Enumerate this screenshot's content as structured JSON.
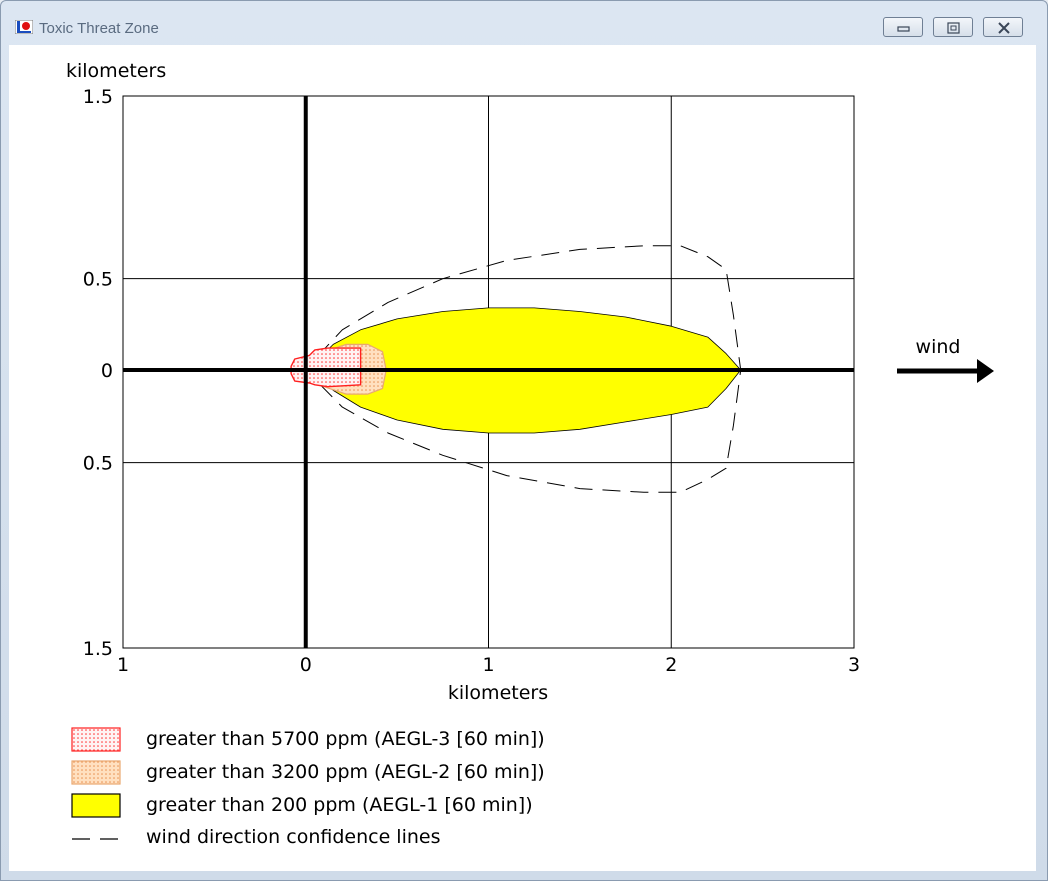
{
  "window": {
    "title": "Toxic Threat Zone",
    "controls": {
      "minimize": "minimize-icon",
      "maximize": "maximize-icon",
      "close": "close-icon"
    }
  },
  "chart_data": {
    "type": "area",
    "title": "",
    "ylabel": "kilometers",
    "xlabel": "kilometers",
    "xlim": [
      -1,
      3
    ],
    "ylim": [
      -1.5,
      1.5
    ],
    "x_ticks": [
      {
        "value": -1,
        "label": "1"
      },
      {
        "value": 0,
        "label": "0"
      },
      {
        "value": 1,
        "label": "1"
      },
      {
        "value": 2,
        "label": "2"
      },
      {
        "value": 3,
        "label": "3"
      }
    ],
    "y_ticks": [
      {
        "value": 1.5,
        "label": "1.5"
      },
      {
        "value": 0.5,
        "label": "0.5"
      },
      {
        "value": 0,
        "label": "0"
      },
      {
        "value": -0.5,
        "label": "0.5"
      },
      {
        "value": -1.5,
        "label": "1.5"
      }
    ],
    "grid": true,
    "wind_label": "wind",
    "series": [
      {
        "name": "greater than 200 ppm (AEGL-1 [60 min])",
        "style": "solid",
        "fill": "#ffff00",
        "stroke": "#000000",
        "points": [
          [
            0.06,
            -0.03
          ],
          [
            0.08,
            0.07
          ],
          [
            0.15,
            0.14
          ],
          [
            0.3,
            0.22
          ],
          [
            0.5,
            0.28
          ],
          [
            0.75,
            0.32
          ],
          [
            1.0,
            0.34
          ],
          [
            1.25,
            0.34
          ],
          [
            1.5,
            0.32
          ],
          [
            1.75,
            0.29
          ],
          [
            2.0,
            0.24
          ],
          [
            2.2,
            0.18
          ],
          [
            2.3,
            0.09
          ],
          [
            2.38,
            0.0
          ],
          [
            2.3,
            -0.1
          ],
          [
            2.2,
            -0.2
          ],
          [
            2.0,
            -0.24
          ],
          [
            1.75,
            -0.28
          ],
          [
            1.5,
            -0.32
          ],
          [
            1.25,
            -0.34
          ],
          [
            1.0,
            -0.34
          ],
          [
            0.75,
            -0.32
          ],
          [
            0.5,
            -0.27
          ],
          [
            0.3,
            -0.2
          ],
          [
            0.15,
            -0.11
          ],
          [
            0.08,
            -0.04
          ]
        ]
      },
      {
        "name": "greater than 3200 ppm (AEGL-2 [60 min])",
        "style": "dotted",
        "fill": "#ffd7a8",
        "stroke": "#e8a870",
        "points": [
          [
            0.02,
            -0.02
          ],
          [
            0.04,
            0.05
          ],
          [
            0.1,
            0.1
          ],
          [
            0.22,
            0.14
          ],
          [
            0.34,
            0.14
          ],
          [
            0.42,
            0.1
          ],
          [
            0.44,
            0.0
          ],
          [
            0.42,
            -0.1
          ],
          [
            0.34,
            -0.13
          ],
          [
            0.22,
            -0.13
          ],
          [
            0.1,
            -0.09
          ],
          [
            0.04,
            -0.05
          ]
        ]
      },
      {
        "name": "greater than 5700 ppm (AEGL-3 [60 min])",
        "style": "dotted",
        "fill": "#ffe3e3",
        "stroke": "#ff2020",
        "points": [
          [
            -0.08,
            0.02
          ],
          [
            -0.06,
            0.06
          ],
          [
            0.02,
            0.08
          ],
          [
            0.05,
            0.11
          ],
          [
            0.12,
            0.12
          ],
          [
            0.3,
            0.12
          ],
          [
            0.3,
            -0.08
          ],
          [
            0.12,
            -0.09
          ],
          [
            0.05,
            -0.08
          ],
          [
            0.02,
            -0.07
          ],
          [
            -0.06,
            -0.06
          ],
          [
            -0.08,
            -0.02
          ]
        ]
      },
      {
        "name": "wind direction confidence lines",
        "style": "dashed",
        "fill": "none",
        "stroke": "#000000",
        "points": [
          [
            0.06,
            0.07
          ],
          [
            0.2,
            0.22
          ],
          [
            0.45,
            0.37
          ],
          [
            0.75,
            0.5
          ],
          [
            1.1,
            0.6
          ],
          [
            1.5,
            0.66
          ],
          [
            1.85,
            0.68
          ],
          [
            2.05,
            0.68
          ],
          [
            2.2,
            0.62
          ],
          [
            2.3,
            0.55
          ],
          [
            2.34,
            0.3
          ],
          [
            2.38,
            0.0
          ],
          [
            2.34,
            -0.3
          ],
          [
            2.3,
            -0.53
          ],
          [
            2.2,
            -0.59
          ],
          [
            2.05,
            -0.66
          ],
          [
            1.85,
            -0.66
          ],
          [
            1.5,
            -0.64
          ],
          [
            1.1,
            -0.57
          ],
          [
            0.75,
            -0.46
          ],
          [
            0.45,
            -0.34
          ],
          [
            0.2,
            -0.2
          ],
          [
            0.06,
            -0.06
          ]
        ]
      }
    ],
    "legend": [
      {
        "label": "greater than 5700 ppm (AEGL-3 [60 min])",
        "swatch": "aegl3"
      },
      {
        "label": "greater than 3200 ppm (AEGL-2 [60 min])",
        "swatch": "aegl2"
      },
      {
        "label": "greater than 200 ppm (AEGL-1 [60 min])",
        "swatch": "aegl1"
      },
      {
        "label": "wind direction confidence lines",
        "swatch": "dashed"
      }
    ],
    "colors": {
      "aegl1": "#ffff00",
      "aegl2": "#ffd7a8",
      "aegl3": "#ff2020"
    }
  }
}
